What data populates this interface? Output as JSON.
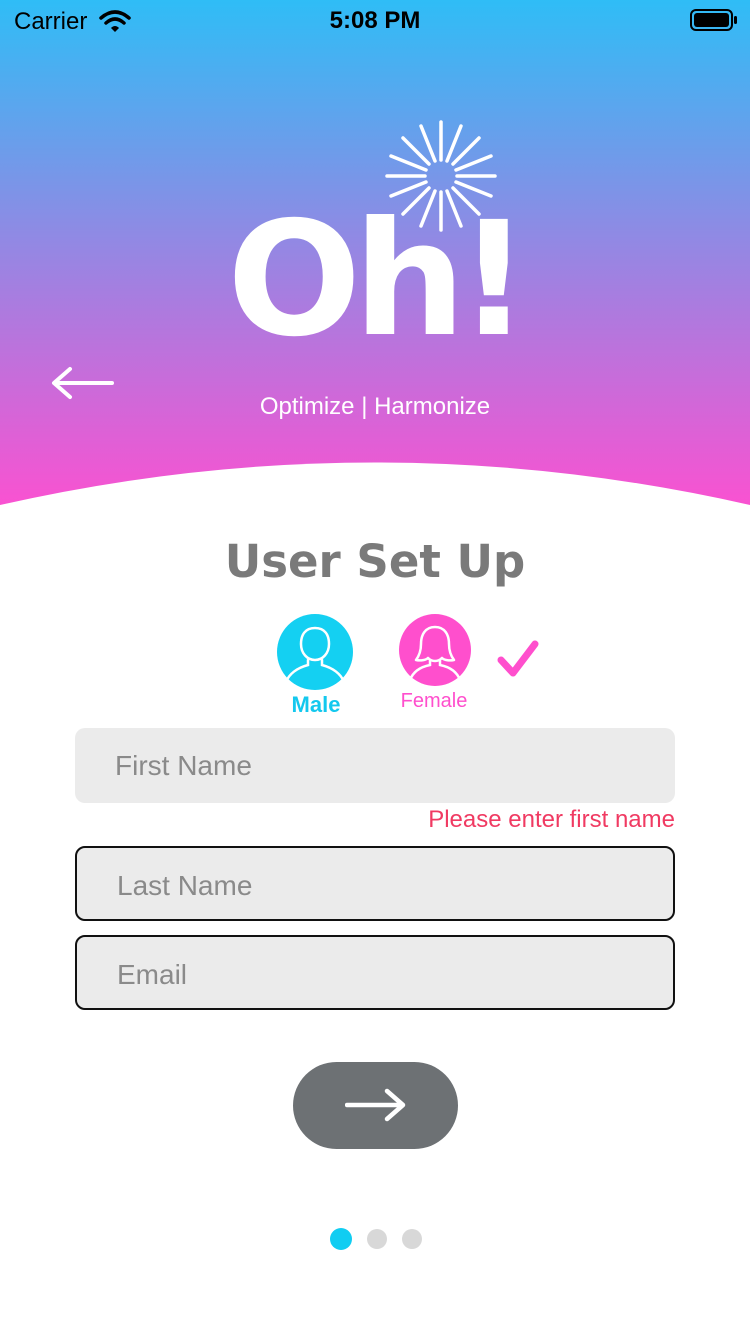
{
  "status_bar": {
    "carrier": "Carrier",
    "time": "5:08 PM"
  },
  "brand": {
    "logo": "Oh!",
    "tagline": "Optimize | Harmonize"
  },
  "page": {
    "title": "User Set Up"
  },
  "gender": {
    "male_label": "Male",
    "female_label": "Female",
    "selected": "Female"
  },
  "form": {
    "first_name_placeholder": "First Name",
    "first_name_error": "Please enter first name",
    "last_name_placeholder": "Last Name",
    "email_placeholder": "Email"
  },
  "pagination": {
    "total": 3,
    "active": 1
  },
  "colors": {
    "gradient_top": "#2fbdf6",
    "gradient_bottom": "#ff4fd0",
    "male": "#14d0f2",
    "female": "#ff4fcd",
    "error": "#f03a62",
    "next_button": "#6d7174"
  },
  "icons": [
    "wifi-icon",
    "battery-icon",
    "back-arrow-icon",
    "burst-icon",
    "male-avatar-icon",
    "female-avatar-icon",
    "checkmark-icon",
    "next-arrow-icon"
  ]
}
